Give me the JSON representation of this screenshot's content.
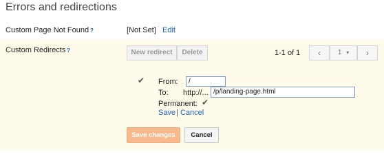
{
  "section_title": "Errors and redirections",
  "custom_page": {
    "label": "Custom Page Not Found",
    "help": "?",
    "value": "[Not Set]",
    "edit": "Edit"
  },
  "redirects": {
    "label": "Custom Redirects",
    "help": "?",
    "new_redirect": "New redirect",
    "delete": "Delete",
    "count": "1-1 of 1",
    "prev": "‹",
    "page": "1",
    "page_caret": "▾",
    "next": "›",
    "row_check": "✔",
    "from_label": "From:",
    "from_value": "/",
    "to_label": "To:",
    "to_prefix": "http://...",
    "to_value": "/p/landing-page.html",
    "permanent_label": "Permanent:",
    "permanent_check": "✔",
    "save": "Save",
    "separator": "|",
    "cancel": "Cancel"
  },
  "actions": {
    "save_changes": "Save changes",
    "cancel": "Cancel"
  }
}
